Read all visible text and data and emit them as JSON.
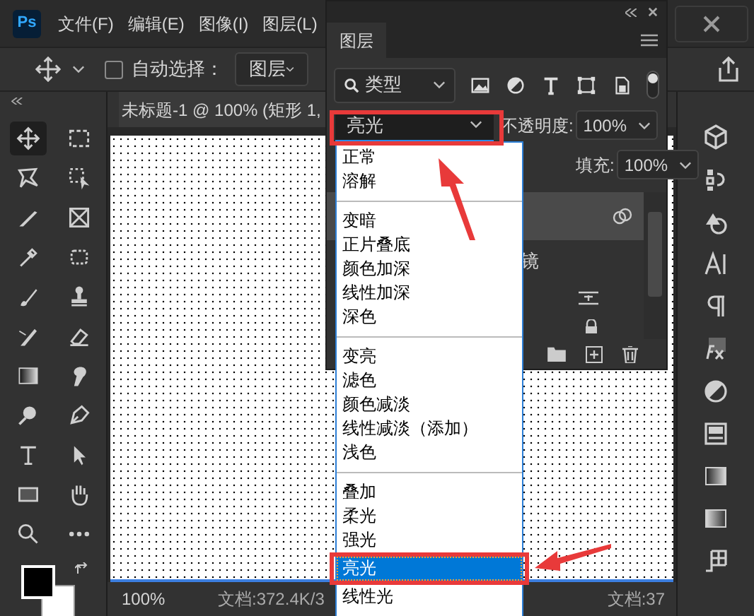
{
  "app": {
    "logo": "Ps"
  },
  "menu": [
    "文件(F)",
    "编辑(E)",
    "图像(I)",
    "图层(L)"
  ],
  "options_bar": {
    "auto_select": {
      "label": "自动选择：",
      "checked": false
    },
    "target": "图层"
  },
  "document_tab": {
    "title": "未标题-1 @ 100% (矩形 1,"
  },
  "status_bar": {
    "zoom": "100%",
    "doc_info": "文档:372.4K/3",
    "doc_info_right": "文档:37"
  },
  "layers_panel": {
    "title": "图层",
    "filter": "类型",
    "blend_mode": "亮光",
    "opacity_label": "不透明度:",
    "opacity": "100%",
    "fill_label": "填充:",
    "fill": "100%",
    "layer_text": "镜"
  },
  "blend_menu": {
    "groups": [
      [
        {
          "label": "正常",
          "selected": false
        },
        {
          "label": "溶解",
          "selected": false
        }
      ],
      [
        {
          "label": "变暗",
          "selected": false
        },
        {
          "label": "正片叠底",
          "selected": false
        },
        {
          "label": "颜色加深",
          "selected": false
        },
        {
          "label": "线性加深",
          "selected": false
        },
        {
          "label": "深色",
          "selected": false
        }
      ],
      [
        {
          "label": "变亮",
          "selected": false
        },
        {
          "label": "滤色",
          "selected": false
        },
        {
          "label": "颜色减淡",
          "selected": false
        },
        {
          "label": "线性减淡（添加）",
          "selected": false
        },
        {
          "label": "浅色",
          "selected": false
        }
      ],
      [
        {
          "label": "叠加",
          "selected": false
        },
        {
          "label": "柔光",
          "selected": false
        },
        {
          "label": "强光",
          "selected": false
        },
        {
          "label": "亮光",
          "selected": true
        },
        {
          "label": "线性光",
          "selected": false
        }
      ]
    ]
  }
}
